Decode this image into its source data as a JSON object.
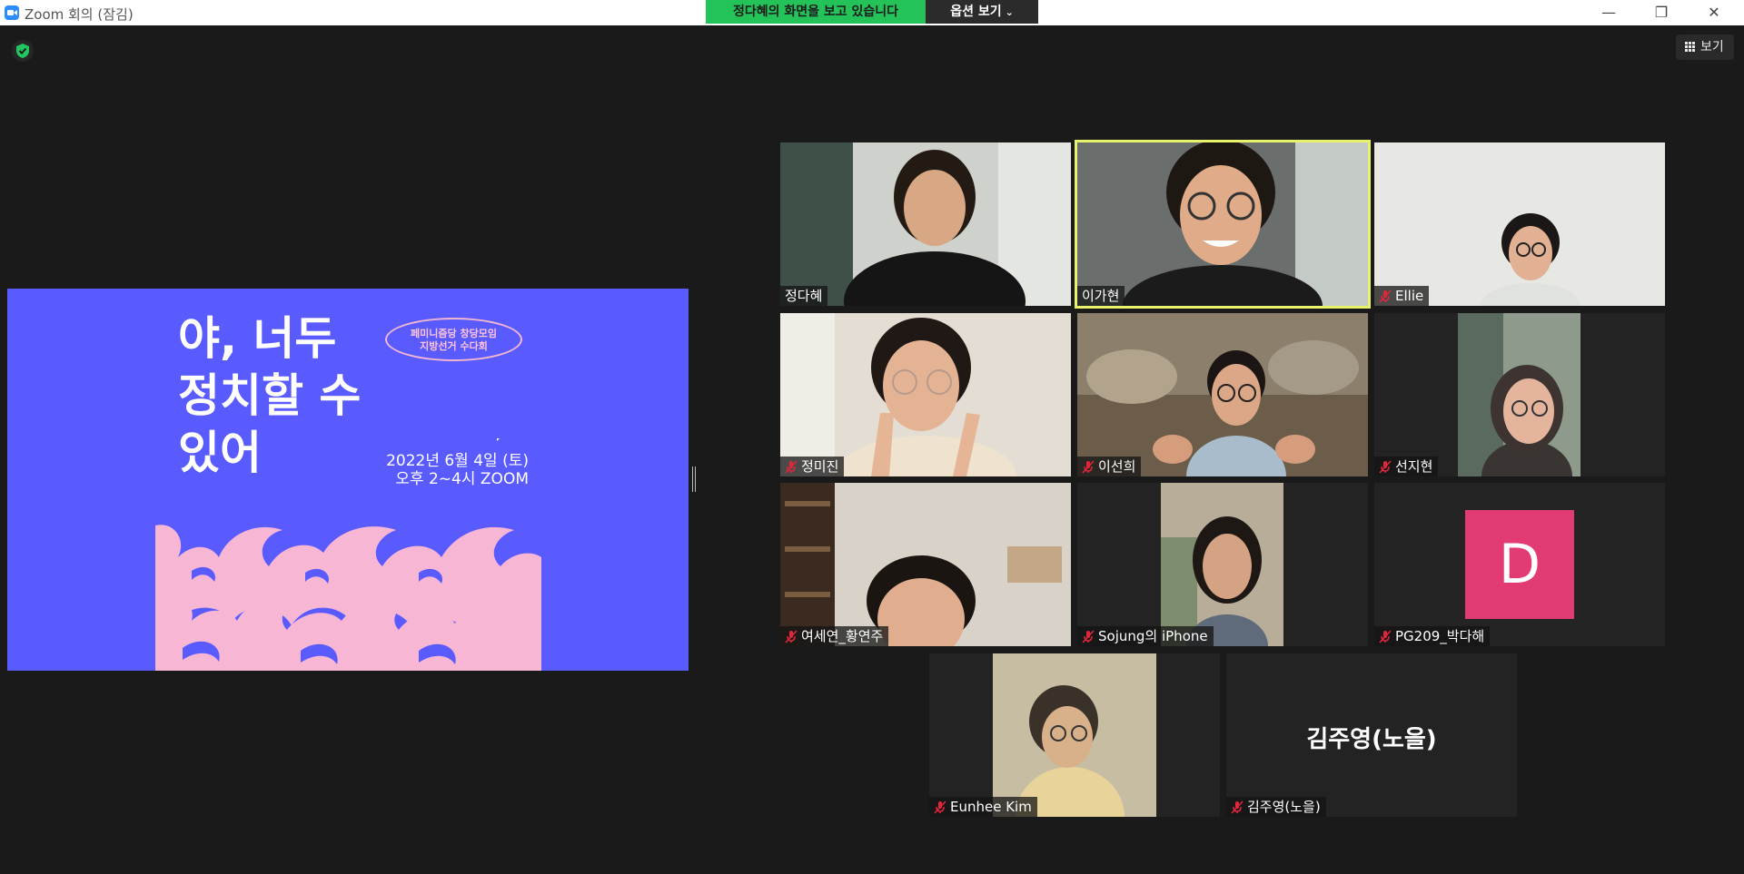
{
  "window": {
    "title": "Zoom 회의 (잠김)",
    "minimize_glyph": "—",
    "maximize_glyph": "❐",
    "close_glyph": "✕"
  },
  "banner": {
    "viewing_text": "정다혜의 화면을 보고 있습니다",
    "options_label": "옵션 보기",
    "options_chevron": "⌄"
  },
  "toolbar": {
    "view_label": "보기",
    "security_icon": "shield-check-icon",
    "view_icon": "grid-icon"
  },
  "slide": {
    "title_lines": [
      "야, 너두",
      "정치할 수",
      "있어"
    ],
    "badge_lines": [
      "페미니즘당 창당모임",
      "지방선거 수다회"
    ],
    "date_lines": [
      "2022년 6월 4일 (토)",
      "오후 2~4시 ZOOM"
    ],
    "background": "#5a5bff",
    "wave_color": "#f7b7d4"
  },
  "participants": [
    {
      "name": "정다혜",
      "muted": false,
      "active": false
    },
    {
      "name": "이가현",
      "muted": false,
      "active": true
    },
    {
      "name": "Ellie",
      "muted": true,
      "active": false
    },
    {
      "name": "정미진",
      "muted": true,
      "active": false
    },
    {
      "name": "이선희",
      "muted": true,
      "active": false
    },
    {
      "name": "선지현",
      "muted": true,
      "active": false
    },
    {
      "name": "여세연_황연주",
      "muted": true,
      "active": false
    },
    {
      "name": "Sojung의 iPhone",
      "muted": true,
      "active": false
    },
    {
      "name": "PG209_박다해",
      "muted": true,
      "active": false,
      "avatar_letter": "D",
      "avatar_color": "#e23a72"
    },
    {
      "name": "Eunhee Kim",
      "muted": true,
      "active": false
    },
    {
      "name": "김주영(노을)",
      "muted": true,
      "active": false,
      "display_name": "김주영(노을)"
    }
  ],
  "colors": {
    "active_speaker_border": "#e8f26a",
    "banner_green": "#23c35a",
    "mute_red": "#e0263b"
  }
}
